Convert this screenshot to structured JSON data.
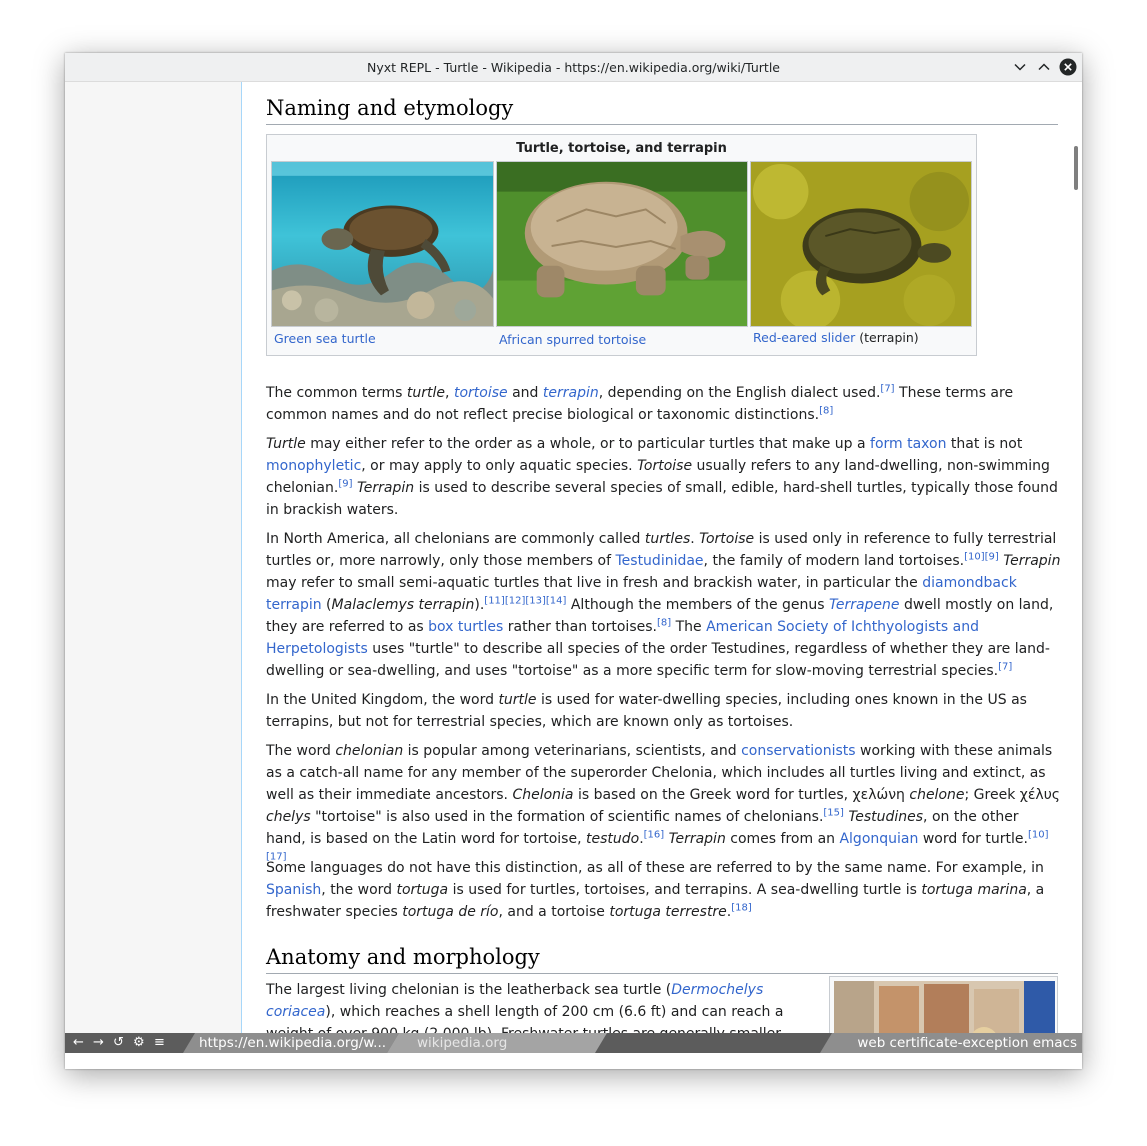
{
  "window": {
    "title": "Nyxt REPL - Turtle - Wikipedia - https://en.wikipedia.org/wiki/Turtle",
    "controls": [
      "chevron-down-icon",
      "chevron-up-icon",
      "close-icon"
    ]
  },
  "article": {
    "section1_heading": "Naming and etymology",
    "gallery": {
      "title": "Turtle, tortoise, and terrapin",
      "captions": [
        {
          "link": "Green sea turtle",
          "text": ""
        },
        {
          "link": "African spurred tortoise",
          "text": ""
        },
        {
          "link": "Red-eared slider",
          "text": " (terrapin)"
        }
      ]
    },
    "p1": {
      "t1": "The common terms ",
      "i1": "turtle",
      "t2": ", ",
      "l1": "tortoise",
      "t3": " and ",
      "l2": "terrapin",
      "t4": ", depending on the English dialect used.",
      "r1": "[7]",
      "t5": " These terms are common names and do not reflect precise biological or taxonomic distinctions.",
      "r2": "[8]"
    },
    "p2": {
      "i1": "Turtle",
      "t1": " may either refer to the order as a whole, or to particular turtles that make up a ",
      "l1": "form taxon",
      "t2": " that is not ",
      "l2": "monophyletic",
      "t3": ", or may apply to only aquatic species. ",
      "i2": "Tortoise",
      "t4": " usually refers to any land-dwelling, non-swimming chelonian.",
      "r1": "[9]",
      "t5": " ",
      "i3": "Terrapin",
      "t6": " is used to describe several species of small, edible, hard-shell turtles, typically those found in brackish waters."
    },
    "p3": {
      "t1": "In North America, all chelonians are commonly called ",
      "i1": "turtles",
      "t2": ". ",
      "i2": "Tortoise",
      "t3": " is used only in reference to fully terrestrial turtles or, more narrowly, only those members of ",
      "l1": "Testudinidae",
      "t4": ", the family of modern land tortoises.",
      "r1": "[10][9]",
      "t5": " ",
      "i3": "Terrapin",
      "t6": " may refer to small semi-aquatic turtles that live in fresh and brackish water, in particular the ",
      "l2": "diamondback terrapin",
      "t7": " (",
      "i4": "Malaclemys terrapin",
      "t8": ").",
      "r2": "[11][12][13][14]",
      "t9": " Although the members of the genus ",
      "l3": "Terrapene",
      "t10": " dwell mostly on land, they are referred to as ",
      "l4": "box turtles",
      "t11": " rather than tortoises.",
      "r3": "[8]",
      "t12": " The ",
      "l5": "American Society of Ichthyologists and Herpetologists",
      "t13": " uses \"turtle\" to describe all species of the order Testudines, regardless of whether they are land-dwelling or sea-dwelling, and uses \"tortoise\" as a more specific term for slow-moving terrestrial species.",
      "r4": "[7]"
    },
    "p4": {
      "t1": "In the United Kingdom, the word ",
      "i1": "turtle",
      "t2": " is used for water-dwelling species, including ones known in the US as terrapins, but not for terrestrial species, which are known only as tortoises."
    },
    "p5": {
      "t1": "The word ",
      "i1": "chelonian",
      "t2": " is popular among veterinarians, scientists, and ",
      "l1": "conservationists",
      "t3": " working with these animals as a catch-all name for any member of the superorder Chelonia, which includes all turtles living and extinct, as well as their immediate ancestors. ",
      "i2": "Chelonia",
      "t4": " is based on the Greek word for turtles, χελώνη ",
      "i3": "chelone",
      "t5": "; Greek χέλυς ",
      "i4": "chelys",
      "t6": " \"tortoise\" is also used in the formation of scientific names of chelonians.",
      "r1": "[15]",
      "t7": " ",
      "i5": "Testudines",
      "t8": ", on the other hand, is based on the Latin word for tortoise, ",
      "i6": "testudo",
      "t9": ".",
      "r2": "[16]",
      "t10": " ",
      "i7": "Terrapin",
      "t11": " comes from an ",
      "l2": "Algonquian",
      "t12": " word for turtle.",
      "r3": "[10][17]"
    },
    "p6": {
      "t1": "Some languages do not have this distinction, as all of these are referred to by the same name. For example, in ",
      "l1": "Spanish",
      "t2": ", the word ",
      "i1": "tortuga",
      "t3": " is used for turtles, tortoises, and terrapins. A sea-dwelling turtle is ",
      "i2": "tortuga marina",
      "t4": ", a freshwater species ",
      "i3": "tortuga de río",
      "t5": ", and a tortoise ",
      "i4": "tortuga terrestre",
      "t6": ".",
      "r1": "[18]"
    },
    "section2_heading": "Anatomy and morphology",
    "p7": {
      "t1": "The largest living chelonian is the leatherback sea turtle (",
      "l1": "Dermochelys coriacea",
      "t2": "), which reaches a shell length of 200 cm (6.6 ft) and can reach a weight of over 900 kg (2,000 lb). Freshwater turtles are generally smaller. The largest terrestrial"
    }
  },
  "statusbar": {
    "nav_icons": [
      "back-arrow-icon",
      "forward-arrow-icon",
      "reload-icon",
      "settings-icon",
      "menu-icon"
    ],
    "nav_glyphs": [
      "←",
      "→",
      "↺",
      "⚙",
      "≡"
    ],
    "url": "https://en.wikipedia.org/w...",
    "domain": "wikipedia.org",
    "modes": "web certificate-exception emacs"
  },
  "colors": {
    "link": "#3366cc",
    "statusbar_dark": "#5c5c5c",
    "statusbar_mid": "#8e8e8e",
    "content_border": "#a7d7f9"
  }
}
